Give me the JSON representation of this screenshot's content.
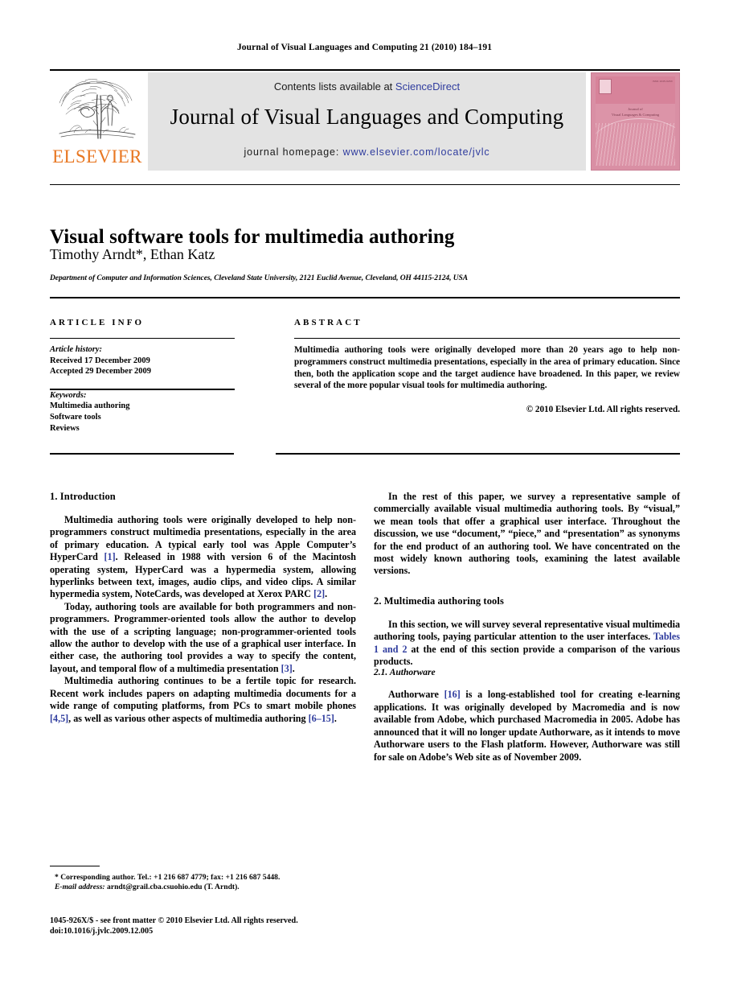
{
  "running_head": "Journal of Visual Languages and Computing 21 (2010) 184–191",
  "masthead": {
    "contents_prefix": "Contents lists available at ",
    "contents_link": "ScienceDirect",
    "journal_title": "Journal of Visual Languages and Computing",
    "homepage_prefix": "journal homepage: ",
    "homepage_link": "www.elsevier.com/locate/jvlc",
    "publisher_wordmark": "ELSEVIER",
    "publisher_color": "#E87722",
    "link_color": "#2F3C9E",
    "panel_color": "#E3E3E3",
    "cover": {
      "issn": "ISSN 1045-926X",
      "title_line1": "Journal of",
      "title_line2": "Visual Languages & Computing",
      "color": "#DC94A8"
    }
  },
  "article": {
    "title": "Visual software tools for multimedia authoring",
    "authors": "Timothy Arndt*, Ethan Katz",
    "affiliation": "Department of Computer and Information Sciences, Cleveland State University, 2121 Euclid Avenue, Cleveland, OH 44115-2124, USA"
  },
  "info": {
    "label": "ARTICLE INFO",
    "history_label": "Article history:",
    "received": "Received 17 December 2009",
    "accepted": "Accepted 29 December 2009",
    "keywords_label": "Keywords:",
    "keywords": [
      "Multimedia authoring",
      "Software tools",
      "Reviews"
    ]
  },
  "abstract": {
    "label": "ABSTRACT",
    "text": "Multimedia authoring tools were originally developed more than 20 years ago to help non-programmers construct multimedia presentations, especially in the area of primary education. Since then, both the application scope and the target audience have broadened. In this paper, we review several of the more popular visual tools for multimedia authoring.",
    "copyright": "© 2010 Elsevier Ltd. All rights reserved."
  },
  "body": {
    "section1_heading": "1.  Introduction",
    "p1_a": "Multimedia authoring tools were originally developed to help non-programmers construct multimedia presentations, especially in the area of primary education. A typical early tool was Apple Computer’s HyperCard ",
    "p1_ref1": "[1]",
    "p1_b": ". Released in 1988 with version 6 of the Macintosh operating system, HyperCard was a hypermedia system, allowing hyperlinks between text, images, audio clips, and video clips. A similar hypermedia system, NoteCards, was developed at Xerox PARC ",
    "p1_ref2": "[2]",
    "p1_c": ".",
    "p2_a": "Today, authoring tools are available for both programmers and non-programmers. Programmer-oriented tools allow the author to develop with the use of a scripting language; non-programmer-oriented tools allow the author to develop with the use of a graphical user interface. In either case, the authoring tool provides a way to specify the content, layout, and temporal flow of a multimedia presentation ",
    "p2_ref": "[3]",
    "p2_b": ".",
    "p3_a": "Multimedia authoring continues to be a fertile topic for research. Recent work includes papers on adapting multimedia documents for a wide range of computing platforms, from PCs to smart mobile phones ",
    "p3_ref1": "[4,5]",
    "p3_b": ", as well as various other aspects of multimedia authoring ",
    "p3_ref2": "[6–15]",
    "p3_c": ".",
    "p4": "In the rest of this paper, we survey a representative sample of commercially available visual multimedia authoring tools. By “visual,” we mean tools that offer a graphical user interface. Throughout the discussion, we use “document,” “piece,” and “presentation” as synonyms for the end product of an authoring tool. We have concentrated on the most widely known authoring tools, examining the latest available versions.",
    "section2_heading": "2.  Multimedia authoring tools",
    "p5_a": "In this section, we will survey several representative visual multimedia authoring tools, paying particular attention to the user interfaces. ",
    "p5_xref": "Tables 1 and 2",
    "p5_b": " at the end of this section provide a comparison of the various products.",
    "subsection21_heading": "2.1.  Authorware",
    "p6_a": "Authorware ",
    "p6_ref": "[16]",
    "p6_b": " is a long-established tool for creating e-learning applications. It was originally developed by Macromedia and is now available from Adobe, which purchased Macromedia in 2005. Adobe has announced that it will no longer update Authorware, as it intends to move Authorware users to the Flash platform. However, Authorware was still for sale on Adobe’s Web site as of November 2009."
  },
  "footer": {
    "corresponding": "* Corresponding author. Tel.: +1 216 687 4779; fax: +1 216 687 5448.",
    "email_label": "E-mail address:",
    "email": " arndt@grail.cba.csuohio.edu (T. Arndt).",
    "imprint_line1": "1045-926X/$ - see front matter © 2010 Elsevier Ltd. All rights reserved.",
    "imprint_line2": "doi:10.1016/j.jvlc.2009.12.005"
  }
}
